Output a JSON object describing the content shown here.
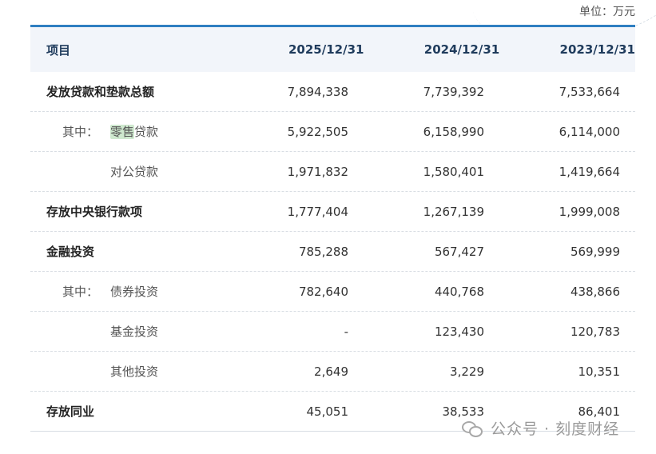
{
  "unit_label": "单位：万元",
  "table": {
    "headers": [
      "项目",
      "2025/12/31",
      "2024/12/31",
      "2023/12/31"
    ],
    "rows": [
      {
        "main": "发放贷款和垫款总额",
        "prefix": "",
        "sub": "",
        "v1": "7,894,338",
        "v2": "7,739,392",
        "v3": "7,533,664"
      },
      {
        "main": "",
        "prefix": "其中：",
        "sub_hl": "零售",
        "sub_rest": "贷款",
        "v1": "5,922,505",
        "v2": "6,158,990",
        "v3": "6,114,000"
      },
      {
        "main": "",
        "prefix": "",
        "sub": "对公贷款",
        "v1": "1,971,832",
        "v2": "1,580,401",
        "v3": "1,419,664"
      },
      {
        "main": "存放中央银行款项",
        "prefix": "",
        "sub": "",
        "v1": "1,777,404",
        "v2": "1,267,139",
        "v3": "1,999,008"
      },
      {
        "main": "金融投资",
        "prefix": "",
        "sub": "",
        "v1": "785,288",
        "v2": "567,427",
        "v3": "569,999"
      },
      {
        "main": "",
        "prefix": "其中：",
        "sub": "债券投资",
        "v1": "782,640",
        "v2": "440,768",
        "v3": "438,866"
      },
      {
        "main": "",
        "prefix": "",
        "sub": "基金投资",
        "v1": "-",
        "v2": "123,430",
        "v3": "120,783"
      },
      {
        "main": "",
        "prefix": "",
        "sub": "其他投资",
        "v1": "2,649",
        "v2": "3,229",
        "v3": "10,351"
      },
      {
        "main": "存放同业",
        "prefix": "",
        "sub": "",
        "v1": "45,051",
        "v2": "38,533",
        "v3": "86,401"
      }
    ]
  },
  "watermark": {
    "text": "公众号 · 刻度财经",
    "icon": "wechat-icon"
  },
  "colors": {
    "header_border": "#2f7fc1",
    "header_bg": "#f2f5fa",
    "highlight": "#cfe9cf"
  }
}
